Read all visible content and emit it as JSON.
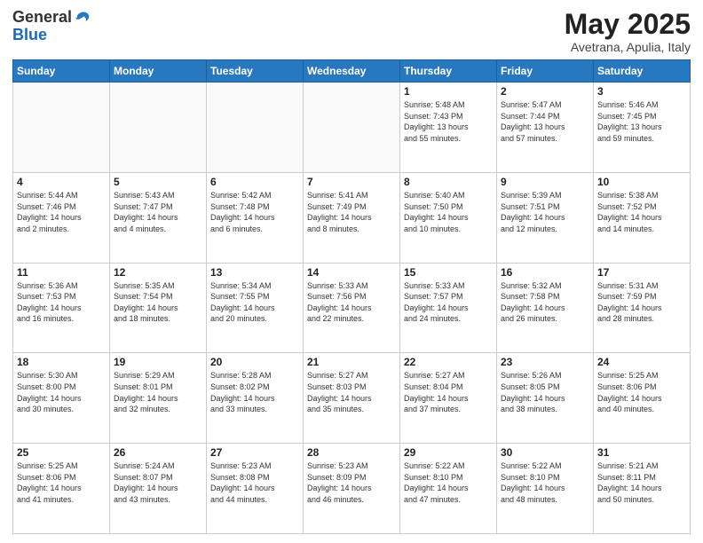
{
  "header": {
    "logo_general": "General",
    "logo_blue": "Blue",
    "month_title": "May 2025",
    "subtitle": "Avetrana, Apulia, Italy"
  },
  "days_of_week": [
    "Sunday",
    "Monday",
    "Tuesday",
    "Wednesday",
    "Thursday",
    "Friday",
    "Saturday"
  ],
  "weeks": [
    [
      {
        "day": "",
        "info": ""
      },
      {
        "day": "",
        "info": ""
      },
      {
        "day": "",
        "info": ""
      },
      {
        "day": "",
        "info": ""
      },
      {
        "day": "1",
        "info": "Sunrise: 5:48 AM\nSunset: 7:43 PM\nDaylight: 13 hours\nand 55 minutes."
      },
      {
        "day": "2",
        "info": "Sunrise: 5:47 AM\nSunset: 7:44 PM\nDaylight: 13 hours\nand 57 minutes."
      },
      {
        "day": "3",
        "info": "Sunrise: 5:46 AM\nSunset: 7:45 PM\nDaylight: 13 hours\nand 59 minutes."
      }
    ],
    [
      {
        "day": "4",
        "info": "Sunrise: 5:44 AM\nSunset: 7:46 PM\nDaylight: 14 hours\nand 2 minutes."
      },
      {
        "day": "5",
        "info": "Sunrise: 5:43 AM\nSunset: 7:47 PM\nDaylight: 14 hours\nand 4 minutes."
      },
      {
        "day": "6",
        "info": "Sunrise: 5:42 AM\nSunset: 7:48 PM\nDaylight: 14 hours\nand 6 minutes."
      },
      {
        "day": "7",
        "info": "Sunrise: 5:41 AM\nSunset: 7:49 PM\nDaylight: 14 hours\nand 8 minutes."
      },
      {
        "day": "8",
        "info": "Sunrise: 5:40 AM\nSunset: 7:50 PM\nDaylight: 14 hours\nand 10 minutes."
      },
      {
        "day": "9",
        "info": "Sunrise: 5:39 AM\nSunset: 7:51 PM\nDaylight: 14 hours\nand 12 minutes."
      },
      {
        "day": "10",
        "info": "Sunrise: 5:38 AM\nSunset: 7:52 PM\nDaylight: 14 hours\nand 14 minutes."
      }
    ],
    [
      {
        "day": "11",
        "info": "Sunrise: 5:36 AM\nSunset: 7:53 PM\nDaylight: 14 hours\nand 16 minutes."
      },
      {
        "day": "12",
        "info": "Sunrise: 5:35 AM\nSunset: 7:54 PM\nDaylight: 14 hours\nand 18 minutes."
      },
      {
        "day": "13",
        "info": "Sunrise: 5:34 AM\nSunset: 7:55 PM\nDaylight: 14 hours\nand 20 minutes."
      },
      {
        "day": "14",
        "info": "Sunrise: 5:33 AM\nSunset: 7:56 PM\nDaylight: 14 hours\nand 22 minutes."
      },
      {
        "day": "15",
        "info": "Sunrise: 5:33 AM\nSunset: 7:57 PM\nDaylight: 14 hours\nand 24 minutes."
      },
      {
        "day": "16",
        "info": "Sunrise: 5:32 AM\nSunset: 7:58 PM\nDaylight: 14 hours\nand 26 minutes."
      },
      {
        "day": "17",
        "info": "Sunrise: 5:31 AM\nSunset: 7:59 PM\nDaylight: 14 hours\nand 28 minutes."
      }
    ],
    [
      {
        "day": "18",
        "info": "Sunrise: 5:30 AM\nSunset: 8:00 PM\nDaylight: 14 hours\nand 30 minutes."
      },
      {
        "day": "19",
        "info": "Sunrise: 5:29 AM\nSunset: 8:01 PM\nDaylight: 14 hours\nand 32 minutes."
      },
      {
        "day": "20",
        "info": "Sunrise: 5:28 AM\nSunset: 8:02 PM\nDaylight: 14 hours\nand 33 minutes."
      },
      {
        "day": "21",
        "info": "Sunrise: 5:27 AM\nSunset: 8:03 PM\nDaylight: 14 hours\nand 35 minutes."
      },
      {
        "day": "22",
        "info": "Sunrise: 5:27 AM\nSunset: 8:04 PM\nDaylight: 14 hours\nand 37 minutes."
      },
      {
        "day": "23",
        "info": "Sunrise: 5:26 AM\nSunset: 8:05 PM\nDaylight: 14 hours\nand 38 minutes."
      },
      {
        "day": "24",
        "info": "Sunrise: 5:25 AM\nSunset: 8:06 PM\nDaylight: 14 hours\nand 40 minutes."
      }
    ],
    [
      {
        "day": "25",
        "info": "Sunrise: 5:25 AM\nSunset: 8:06 PM\nDaylight: 14 hours\nand 41 minutes."
      },
      {
        "day": "26",
        "info": "Sunrise: 5:24 AM\nSunset: 8:07 PM\nDaylight: 14 hours\nand 43 minutes."
      },
      {
        "day": "27",
        "info": "Sunrise: 5:23 AM\nSunset: 8:08 PM\nDaylight: 14 hours\nand 44 minutes."
      },
      {
        "day": "28",
        "info": "Sunrise: 5:23 AM\nSunset: 8:09 PM\nDaylight: 14 hours\nand 46 minutes."
      },
      {
        "day": "29",
        "info": "Sunrise: 5:22 AM\nSunset: 8:10 PM\nDaylight: 14 hours\nand 47 minutes."
      },
      {
        "day": "30",
        "info": "Sunrise: 5:22 AM\nSunset: 8:10 PM\nDaylight: 14 hours\nand 48 minutes."
      },
      {
        "day": "31",
        "info": "Sunrise: 5:21 AM\nSunset: 8:11 PM\nDaylight: 14 hours\nand 50 minutes."
      }
    ]
  ]
}
